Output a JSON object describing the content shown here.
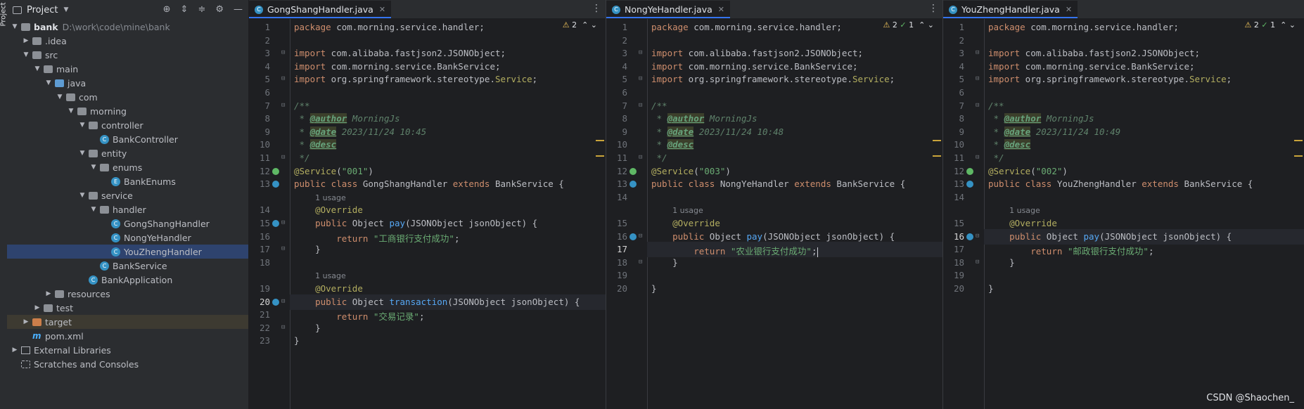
{
  "sidebar_strip": {
    "label": "Project"
  },
  "project_panel": {
    "title": "Project",
    "tree": [
      {
        "label": "bank",
        "path": "D:\\work\\code\\mine\\bank",
        "indent": 0,
        "arrow": "v",
        "icon": "folder"
      },
      {
        "label": ".idea",
        "indent": 1,
        "arrow": ">",
        "icon": "folder"
      },
      {
        "label": "src",
        "indent": 1,
        "arrow": "v",
        "icon": "folder"
      },
      {
        "label": "main",
        "indent": 2,
        "arrow": "v",
        "icon": "folder"
      },
      {
        "label": "java",
        "indent": 3,
        "arrow": "v",
        "icon": "folder-blue"
      },
      {
        "label": "com",
        "indent": 4,
        "arrow": "v",
        "icon": "folder"
      },
      {
        "label": "morning",
        "indent": 5,
        "arrow": "v",
        "icon": "folder"
      },
      {
        "label": "controller",
        "indent": 6,
        "arrow": "v",
        "icon": "folder"
      },
      {
        "label": "BankController",
        "indent": 7,
        "arrow": "",
        "icon": "class"
      },
      {
        "label": "entity",
        "indent": 6,
        "arrow": "v",
        "icon": "folder"
      },
      {
        "label": "enums",
        "indent": 7,
        "arrow": "v",
        "icon": "folder"
      },
      {
        "label": "BankEnums",
        "indent": 8,
        "arrow": "",
        "icon": "enum"
      },
      {
        "label": "service",
        "indent": 6,
        "arrow": "v",
        "icon": "folder"
      },
      {
        "label": "handler",
        "indent": 7,
        "arrow": "v",
        "icon": "folder"
      },
      {
        "label": "GongShangHandler",
        "indent": 8,
        "arrow": "",
        "icon": "class"
      },
      {
        "label": "NongYeHandler",
        "indent": 8,
        "arrow": "",
        "icon": "class"
      },
      {
        "label": "YouZhengHandler",
        "indent": 8,
        "arrow": "",
        "icon": "class",
        "selected": true
      },
      {
        "label": "BankService",
        "indent": 7,
        "arrow": "",
        "icon": "class"
      },
      {
        "label": "BankApplication",
        "indent": 6,
        "arrow": "",
        "icon": "class"
      },
      {
        "label": "resources",
        "indent": 3,
        "arrow": ">",
        "icon": "folder"
      },
      {
        "label": "test",
        "indent": 2,
        "arrow": ">",
        "icon": "folder"
      },
      {
        "label": "target",
        "indent": 1,
        "arrow": ">",
        "icon": "folder-orange",
        "highlight": true
      },
      {
        "label": "pom.xml",
        "indent": 1,
        "arrow": "",
        "icon": "maven"
      },
      {
        "label": "External Libraries",
        "indent": 0,
        "arrow": ">",
        "icon": "library"
      },
      {
        "label": "Scratches and Consoles",
        "indent": 0,
        "arrow": "",
        "icon": "scratch"
      }
    ]
  },
  "editors": [
    {
      "tab": "GongShangHandler.java",
      "indicators": {
        "warnings": "2",
        "checks": ""
      },
      "lines": [
        {
          "n": "1",
          "code": "<span class=\"kw\">package</span> com.morning.service.handler;"
        },
        {
          "n": "2",
          "code": ""
        },
        {
          "n": "3",
          "code": "<span class=\"kw\">import</span> com.alibaba.fastjson2.JSONObject;",
          "fold": true
        },
        {
          "n": "4",
          "code": "<span class=\"kw\">import</span> com.morning.service.BankService;"
        },
        {
          "n": "5",
          "code": "<span class=\"kw\">import</span> org.springframework.stereotype.<span class=\"ann\">Service</span>;",
          "fold": true
        },
        {
          "n": "6",
          "code": ""
        },
        {
          "n": "7",
          "code": "<span class=\"doc\">/**</span>",
          "fold": true
        },
        {
          "n": "8",
          "code": "<span class=\"doc\"> * </span><span class=\"tag\">@author</span><span class=\"doc\"> MorningJs</span>"
        },
        {
          "n": "9",
          "code": "<span class=\"doc\"> * </span><span class=\"tag\">@date</span><span class=\"doc\"> 2023/11/24 10:45</span>"
        },
        {
          "n": "10",
          "code": "<span class=\"doc\"> * </span><span class=\"tag\">@desc</span>"
        },
        {
          "n": "11",
          "code": "<span class=\"doc\"> */</span>",
          "fold": true
        },
        {
          "n": "12",
          "code": "<span class=\"ann\">@Service</span>(<span class=\"str\">\"001\"</span>)",
          "gicon": "bean"
        },
        {
          "n": "13",
          "code": "<span class=\"kw\">public class</span> GongShangHandler <span class=\"kw\">extends</span> BankService {",
          "gicon": "impl"
        },
        {
          "n": "",
          "code": "    <span class=\"hint\">1 usage</span>"
        },
        {
          "n": "14",
          "code": "    <span class=\"ann\">@Override</span>"
        },
        {
          "n": "15",
          "code": "    <span class=\"kw\">public</span> Object <span class=\"fn\">pay</span>(JSONObject jsonObject) {",
          "gicon": "impl",
          "fold": true
        },
        {
          "n": "16",
          "code": "        <span class=\"kw\">return</span> <span class=\"str\">\"工商银行支付成功\"</span>;"
        },
        {
          "n": "17",
          "code": "    }",
          "fold": true
        },
        {
          "n": "18",
          "code": ""
        },
        {
          "n": "",
          "code": "    <span class=\"hint\">1 usage</span>"
        },
        {
          "n": "19",
          "code": "    <span class=\"ann\">@Override</span>"
        },
        {
          "n": "20",
          "code": "    <span class=\"kw\">public</span> Object <span class=\"fn\">transaction</span>(JSONObject jsonObject) {",
          "gicon": "impl",
          "fold": true,
          "current": true
        },
        {
          "n": "21",
          "code": "        <span class=\"kw\">return</span> <span class=\"str\">\"交易记录\"</span>;"
        },
        {
          "n": "22",
          "code": "    }",
          "fold": true
        },
        {
          "n": "23",
          "code": "}"
        }
      ]
    },
    {
      "tab": "NongYeHandler.java",
      "indicators": {
        "warnings": "2",
        "checks": "1"
      },
      "lines": [
        {
          "n": "1",
          "code": "<span class=\"kw\">package</span> com.morning.service.handler;"
        },
        {
          "n": "2",
          "code": ""
        },
        {
          "n": "3",
          "code": "<span class=\"kw\">import</span> com.alibaba.fastjson2.JSONObject;",
          "fold": true
        },
        {
          "n": "4",
          "code": "<span class=\"kw\">import</span> com.morning.service.BankService;"
        },
        {
          "n": "5",
          "code": "<span class=\"kw\">import</span> org.springframework.stereotype.<span class=\"ann\">Service</span>;",
          "fold": true
        },
        {
          "n": "6",
          "code": ""
        },
        {
          "n": "7",
          "code": "<span class=\"doc\">/**</span>",
          "fold": true
        },
        {
          "n": "8",
          "code": "<span class=\"doc\"> * </span><span class=\"tag\">@author</span><span class=\"doc\"> MorningJs</span>"
        },
        {
          "n": "9",
          "code": "<span class=\"doc\"> * </span><span class=\"tag\">@date</span><span class=\"doc\"> 2023/11/24 10:48</span>"
        },
        {
          "n": "10",
          "code": "<span class=\"doc\"> * </span><span class=\"tag\">@desc</span>"
        },
        {
          "n": "11",
          "code": "<span class=\"doc\"> */</span>",
          "fold": true
        },
        {
          "n": "12",
          "code": "<span class=\"ann\">@Service</span>(<span class=\"str\">\"003\"</span>)",
          "gicon": "bean"
        },
        {
          "n": "13",
          "code": "<span class=\"kw\">public class</span> NongYeHandler <span class=\"kw\">extends</span> BankService {",
          "gicon": "impl"
        },
        {
          "n": "14",
          "code": ""
        },
        {
          "n": "",
          "code": "    <span class=\"hint\">1 usage</span>"
        },
        {
          "n": "15",
          "code": "    <span class=\"ann\">@Override</span>"
        },
        {
          "n": "16",
          "code": "    <span class=\"kw\">public</span> Object <span class=\"fn\">pay</span>(JSONObject jsonObject) {",
          "gicon": "impl",
          "fold": true
        },
        {
          "n": "17",
          "code": "        <span class=\"kw\">return</span> <span class=\"str\">\"农业银行支付成功\"</span>;<span class=\"cursor\"></span>",
          "current": true
        },
        {
          "n": "18",
          "code": "    }",
          "fold": true
        },
        {
          "n": "19",
          "code": ""
        },
        {
          "n": "20",
          "code": "}"
        }
      ]
    },
    {
      "tab": "YouZhengHandler.java",
      "indicators": {
        "warnings": "2",
        "checks": "1"
      },
      "lines": [
        {
          "n": "1",
          "code": "<span class=\"kw\">package</span> com.morning.service.handler;"
        },
        {
          "n": "2",
          "code": ""
        },
        {
          "n": "3",
          "code": "<span class=\"kw\">import</span> com.alibaba.fastjson2.JSONObject;",
          "fold": true
        },
        {
          "n": "4",
          "code": "<span class=\"kw\">import</span> com.morning.service.BankService;"
        },
        {
          "n": "5",
          "code": "<span class=\"kw\">import</span> org.springframework.stereotype.<span class=\"ann\">Service</span>;",
          "fold": true
        },
        {
          "n": "6",
          "code": ""
        },
        {
          "n": "7",
          "code": "<span class=\"doc\">/**</span>",
          "fold": true
        },
        {
          "n": "8",
          "code": "<span class=\"doc\"> * </span><span class=\"tag\">@author</span><span class=\"doc\"> MorningJs</span>"
        },
        {
          "n": "9",
          "code": "<span class=\"doc\"> * </span><span class=\"tag\">@date</span><span class=\"doc\"> 2023/11/24 10:49</span>"
        },
        {
          "n": "10",
          "code": "<span class=\"doc\"> * </span><span class=\"tag\">@desc</span>"
        },
        {
          "n": "11",
          "code": "<span class=\"doc\"> */</span>",
          "fold": true
        },
        {
          "n": "12",
          "code": "<span class=\"ann\">@Service</span>(<span class=\"str\">\"002\"</span>)",
          "gicon": "bean"
        },
        {
          "n": "13",
          "code": "<span class=\"kw\">public class</span> YouZhengHandler <span class=\"kw\">extends</span> BankService {",
          "gicon": "impl"
        },
        {
          "n": "14",
          "code": ""
        },
        {
          "n": "",
          "code": "    <span class=\"hint\">1 usage</span>"
        },
        {
          "n": "15",
          "code": "    <span class=\"ann\">@Override</span>"
        },
        {
          "n": "16",
          "code": "    <span class=\"kw\">public</span> Object <span class=\"fn\">pay</span>(JSONObject jsonObject) {",
          "gicon": "impl",
          "fold": true,
          "current": true
        },
        {
          "n": "17",
          "code": "        <span class=\"kw\">return</span> <span class=\"str\">\"邮政银行支付成功\"</span>;"
        },
        {
          "n": "18",
          "code": "    }",
          "fold": true
        },
        {
          "n": "19",
          "code": ""
        },
        {
          "n": "20",
          "code": "}"
        }
      ]
    }
  ],
  "watermark": "CSDN @Shaochen_"
}
